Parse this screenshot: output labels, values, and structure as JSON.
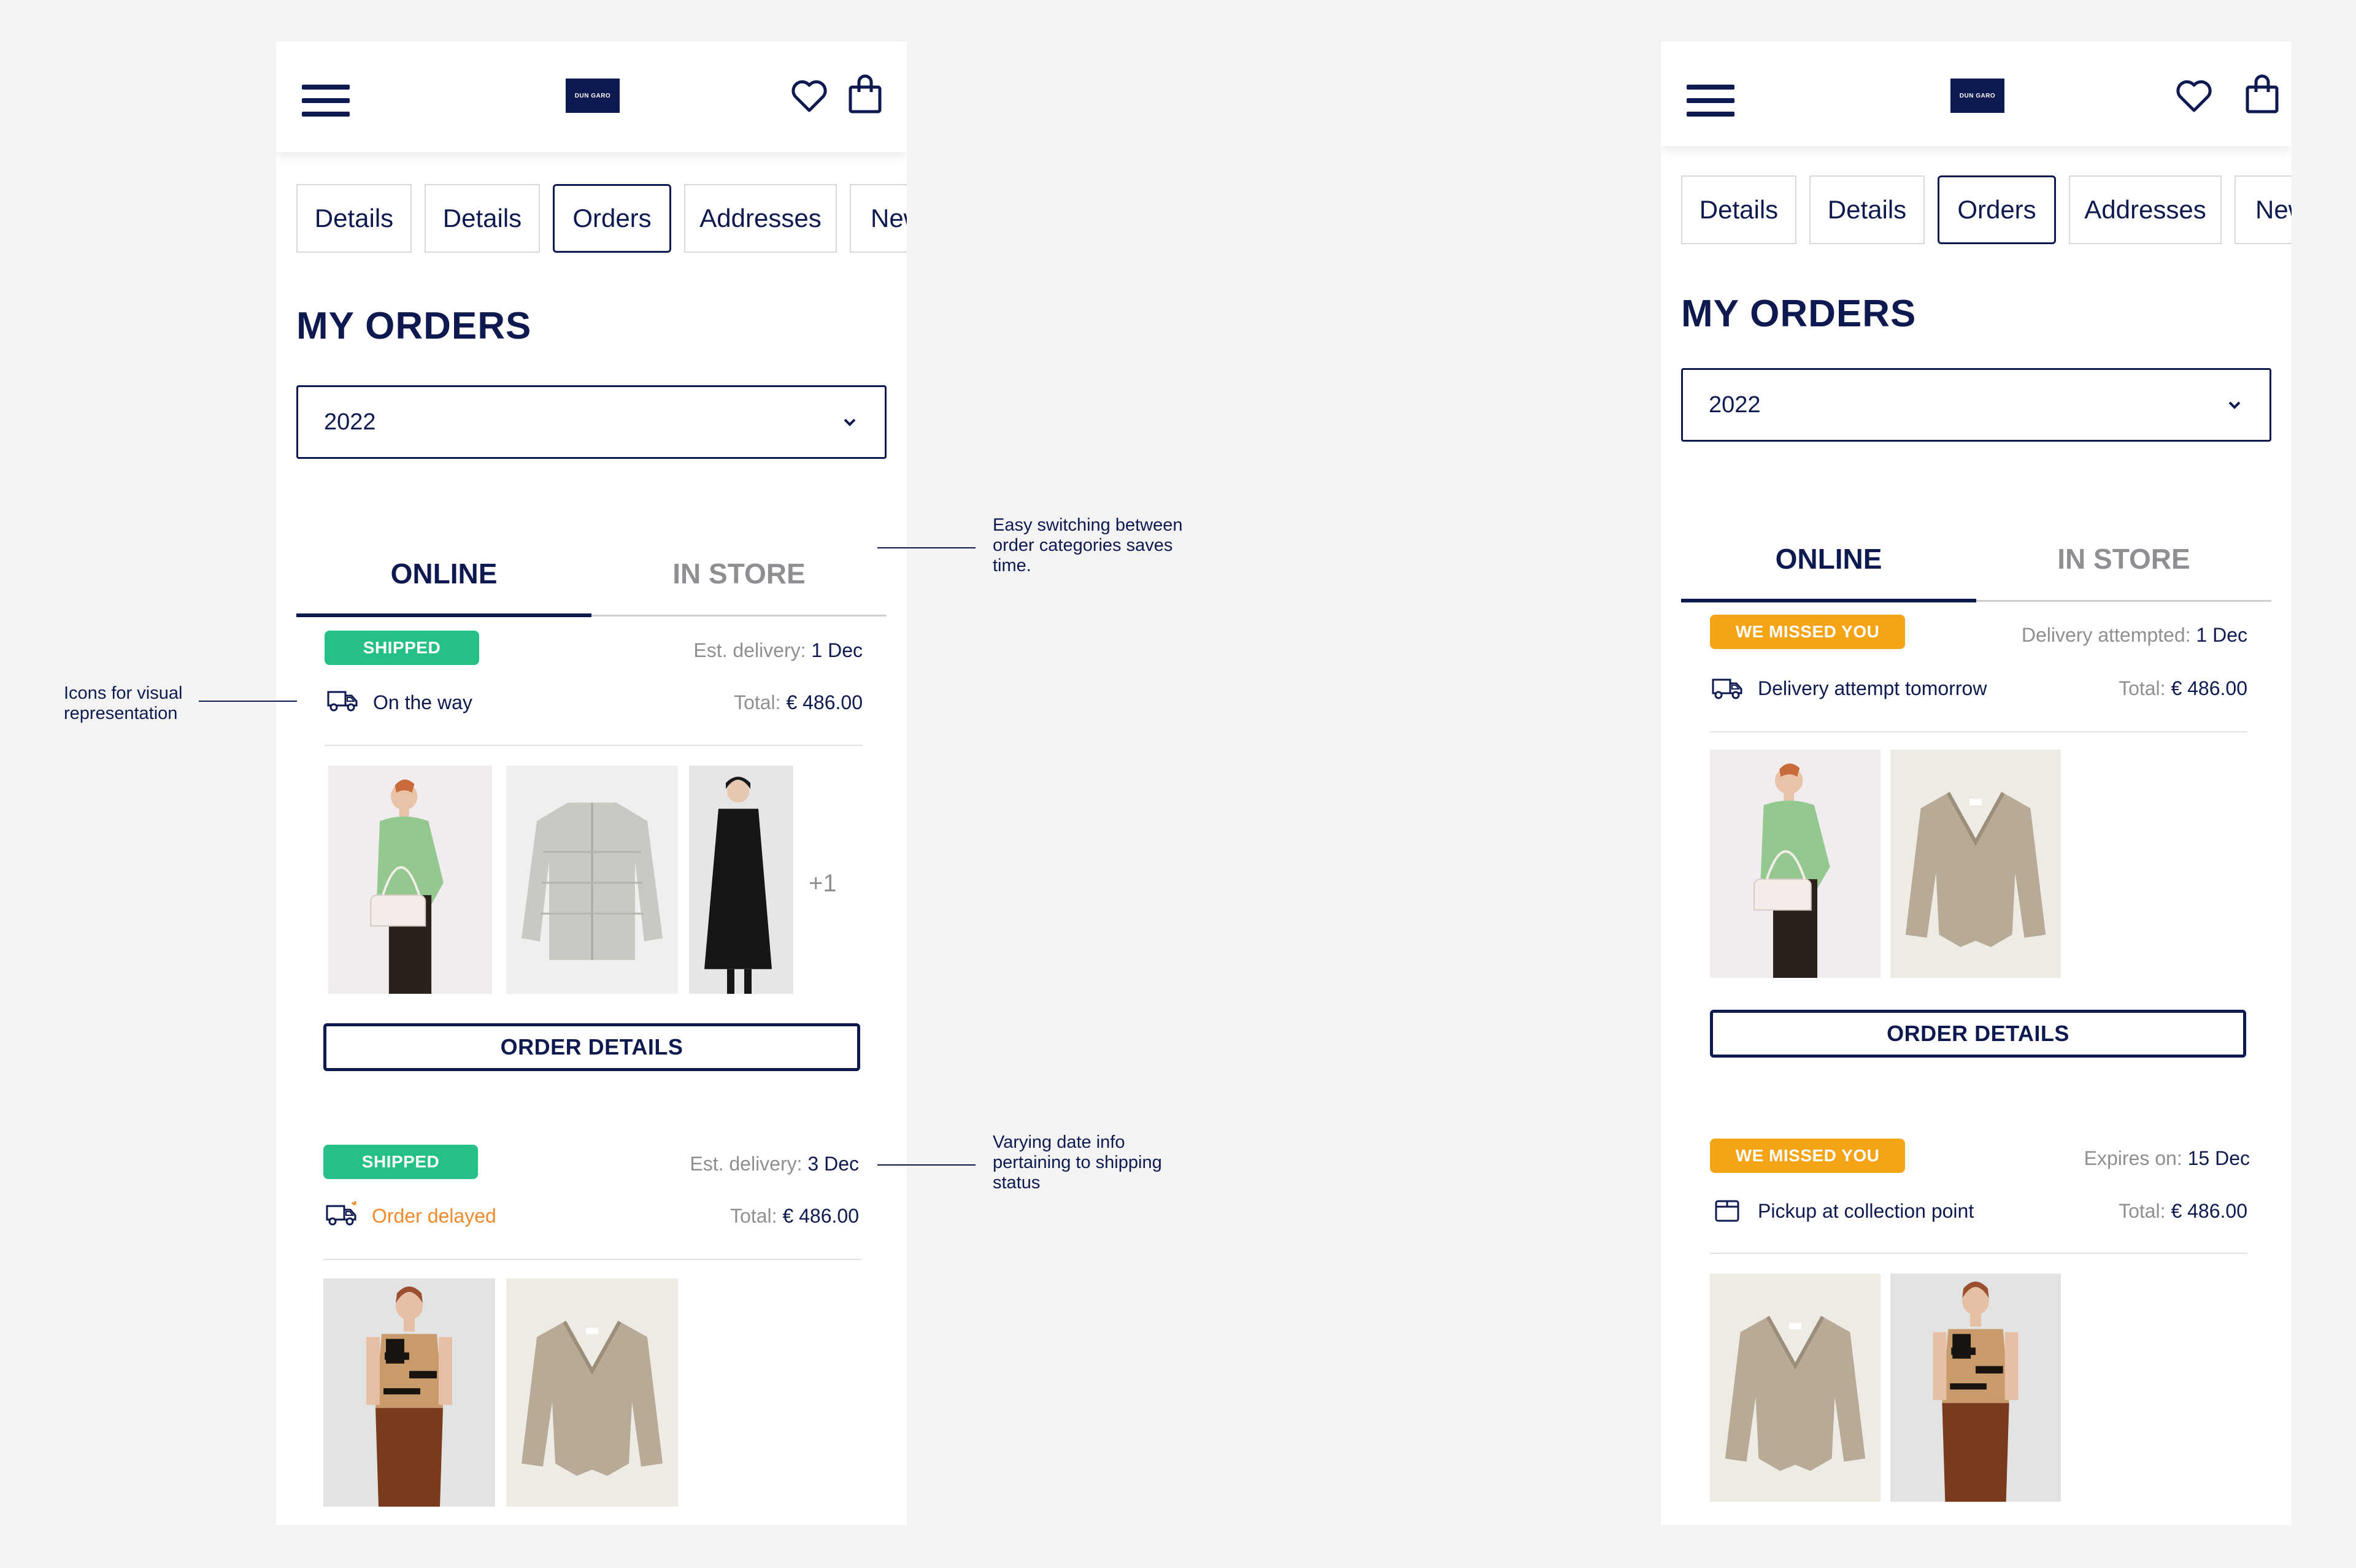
{
  "colors": {
    "navy": "#0e1a4f",
    "green": "#24c086",
    "orange": "#f4a416",
    "delayed": "#f08a2a",
    "gray": "#8e8f92"
  },
  "annotations": {
    "switching": "Easy switching between order categories saves time.",
    "icons": "Icons for visual representation",
    "dates": "Varying date info pertaining to shipping status"
  },
  "screens": [
    {
      "header": {
        "logo": "DUN GARO",
        "menu_icon": "hamburger-icon",
        "wishlist_icon": "heart-icon",
        "bag_icon": "shopping-bag-icon"
      },
      "tabs": [
        "Details",
        "Details",
        "Orders",
        "Addresses",
        "New"
      ],
      "active_tab": "Orders",
      "title": "MY ORDERS",
      "year": "2022",
      "segments": {
        "online": "ONLINE",
        "store": "IN STORE",
        "selected": "ONLINE"
      },
      "orders": [
        {
          "badge": "SHIPPED",
          "badge_color": "green",
          "date_label": "Est. delivery:",
          "date_value": "1 Dec",
          "status": "On the way",
          "status_icon": "truck-icon",
          "total_label": "Total:",
          "total_value": "€ 486.00",
          "items": [
            "green-cardigan-model",
            "quilted-grey-jacket",
            "black-long-coat"
          ],
          "more": "+1",
          "button": "ORDER DETAILS"
        },
        {
          "badge": "SHIPPED",
          "badge_color": "green",
          "date_label": "Est. delivery:",
          "date_value": "3 Dec",
          "status": "Order delayed",
          "status_icon": "truck-delayed-icon",
          "total_label": "Total:",
          "total_value": "€ 486.00",
          "items": [
            "knit-vest-model",
            "beige-cardigan"
          ]
        }
      ]
    },
    {
      "header": {
        "logo": "DUN GARO",
        "menu_icon": "hamburger-icon",
        "wishlist_icon": "heart-icon",
        "bag_icon": "shopping-bag-icon"
      },
      "tabs": [
        "Details",
        "Details",
        "Orders",
        "Addresses",
        "New"
      ],
      "active_tab": "Orders",
      "title": "MY ORDERS",
      "year": "2022",
      "segments": {
        "online": "ONLINE",
        "store": "IN STORE",
        "selected": "ONLINE"
      },
      "orders": [
        {
          "badge": "WE MISSED YOU",
          "badge_color": "orange",
          "date_label": "Delivery attempted:",
          "date_value": "1 Dec",
          "status": "Delivery attempt tomorrow",
          "status_icon": "truck-icon",
          "total_label": "Total:",
          "total_value": "€ 486.00",
          "items": [
            "green-cardigan-model",
            "beige-cardigan"
          ],
          "button": "ORDER DETAILS"
        },
        {
          "badge": "WE MISSED YOU",
          "badge_color": "orange",
          "date_label": "Expires on:",
          "date_value": "15 Dec",
          "status": "Pickup at collection point",
          "status_icon": "package-icon",
          "total_label": "Total:",
          "total_value": "€ 486.00",
          "items": [
            "beige-cardigan",
            "knit-vest-model"
          ]
        }
      ]
    }
  ]
}
